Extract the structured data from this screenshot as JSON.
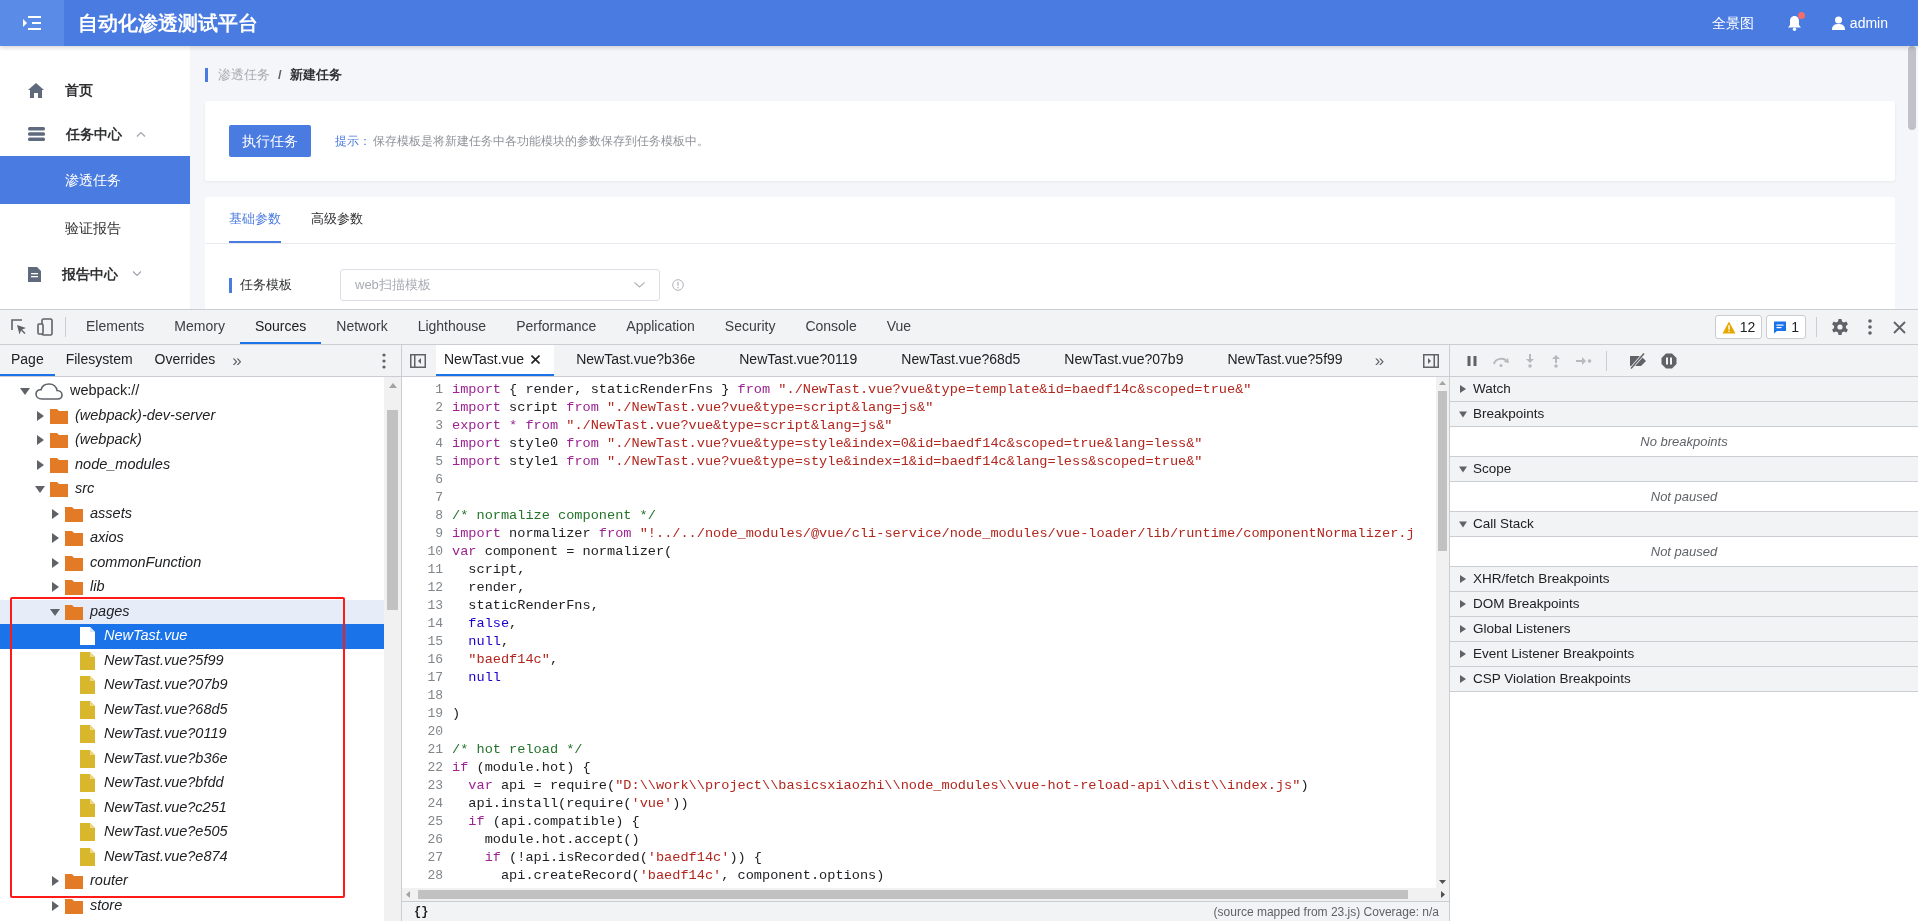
{
  "header": {
    "title": "自动化渗透测试平台",
    "overview_link": "全景图",
    "bell": {
      "unread": true
    },
    "user": "admin"
  },
  "sidebar": {
    "items": [
      {
        "label": "首页",
        "kind": "home",
        "selected": false
      },
      {
        "label": "任务中心",
        "kind": "stack",
        "expanded": true,
        "selected": false,
        "children": [
          {
            "label": "渗透任务",
            "selected": true
          },
          {
            "label": "验证报告",
            "selected": false
          }
        ]
      },
      {
        "label": "报告中心",
        "kind": "document",
        "expanded": false,
        "selected": false
      }
    ]
  },
  "breadcrumb": [
    "渗透任务",
    "新建任务"
  ],
  "breadcrumb_separator": "/",
  "action_card": {
    "button": "执行任务",
    "tip_label": "提示：",
    "tip_text": "保存模板是将新建任务中各功能模块的参数保存到任务模板中。"
  },
  "form_tabs": [
    {
      "label": "基础参数",
      "selected": true
    },
    {
      "label": "高级参数",
      "selected": false
    }
  ],
  "form": {
    "label": "任务模板",
    "select_value": "web扫描模板"
  },
  "devtools": {
    "tabs": [
      {
        "label": "Elements",
        "selected": false
      },
      {
        "label": "Memory",
        "selected": false
      },
      {
        "label": "Sources",
        "selected": true
      },
      {
        "label": "Network",
        "selected": false
      },
      {
        "label": "Lighthouse",
        "selected": false
      },
      {
        "label": "Performance",
        "selected": false
      },
      {
        "label": "Application",
        "selected": false
      },
      {
        "label": "Security",
        "selected": false
      },
      {
        "label": "Console",
        "selected": false
      },
      {
        "label": "Vue",
        "selected": false
      }
    ],
    "warnings": "12",
    "messages": "1",
    "navigator_tabs": [
      {
        "label": "Page",
        "selected": true
      },
      {
        "label": "Filesystem",
        "selected": false
      },
      {
        "label": "Overrides",
        "selected": false
      }
    ],
    "navigator_more": "»",
    "tree": [
      {
        "label": "webpack://",
        "kind": "cloud",
        "expanded": true,
        "selected": false,
        "hovered": false,
        "children": [
          {
            "label": "(webpack)-dev-server",
            "kind": "folder",
            "expanded": false,
            "selected": false,
            "hovered": false
          },
          {
            "label": "(webpack)",
            "kind": "folder",
            "expanded": false,
            "selected": false,
            "hovered": false
          },
          {
            "label": "node_modules",
            "kind": "folder",
            "expanded": false,
            "selected": false,
            "hovered": false
          },
          {
            "label": "src",
            "kind": "folder",
            "expanded": true,
            "selected": false,
            "hovered": false,
            "children": [
              {
                "label": "assets",
                "kind": "folder",
                "expanded": false,
                "selected": false,
                "hovered": false
              },
              {
                "label": "axios",
                "kind": "folder",
                "expanded": false,
                "selected": false,
                "hovered": false
              },
              {
                "label": "commonFunction",
                "kind": "folder",
                "expanded": false,
                "selected": false,
                "hovered": false
              },
              {
                "label": "lib",
                "kind": "folder",
                "expanded": false,
                "selected": false,
                "hovered": false
              },
              {
                "label": "pages",
                "kind": "folder",
                "expanded": true,
                "selected": false,
                "hovered": true,
                "children": [
                  {
                    "label": "NewTast.vue",
                    "kind": "file",
                    "selected": true,
                    "hovered": false
                  },
                  {
                    "label": "NewTast.vue?5f99",
                    "kind": "file",
                    "selected": false,
                    "hovered": false
                  },
                  {
                    "label": "NewTast.vue?07b9",
                    "kind": "file",
                    "selected": false,
                    "hovered": false
                  },
                  {
                    "label": "NewTast.vue?68d5",
                    "kind": "file",
                    "selected": false,
                    "hovered": false
                  },
                  {
                    "label": "NewTast.vue?0119",
                    "kind": "file",
                    "selected": false,
                    "hovered": false
                  },
                  {
                    "label": "NewTast.vue?b36e",
                    "kind": "file",
                    "selected": false,
                    "hovered": false
                  },
                  {
                    "label": "NewTast.vue?bfdd",
                    "kind": "file",
                    "selected": false,
                    "hovered": false
                  },
                  {
                    "label": "NewTast.vue?c251",
                    "kind": "file",
                    "selected": false,
                    "hovered": false
                  },
                  {
                    "label": "NewTast.vue?e505",
                    "kind": "file",
                    "selected": false,
                    "hovered": false
                  },
                  {
                    "label": "NewTast.vue?e874",
                    "kind": "file",
                    "selected": false,
                    "hovered": false
                  }
                ]
              },
              {
                "label": "router",
                "kind": "folder",
                "expanded": false,
                "selected": false,
                "hovered": false
              },
              {
                "label": "store",
                "kind": "folder",
                "expanded": false,
                "selected": false,
                "hovered": false
              }
            ]
          }
        ]
      }
    ],
    "editor_tabs": [
      {
        "label": "NewTast.vue",
        "selected": true
      },
      {
        "label": "NewTast.vue?b36e",
        "selected": false
      },
      {
        "label": "NewTast.vue?0119",
        "selected": false
      },
      {
        "label": "NewTast.vue?68d5",
        "selected": false
      },
      {
        "label": "NewTast.vue?07b9",
        "selected": false
      },
      {
        "label": "NewTast.vue?5f99",
        "selected": false
      }
    ],
    "editor_more": "»",
    "code": [
      {
        "number": "1",
        "tokens": [
          {
            "kind": "kw",
            "text": "import"
          },
          {
            "kind": "plain",
            "text": " { render, staticRenderFns } "
          },
          {
            "kind": "kw",
            "text": "from "
          },
          {
            "kind": "str",
            "text": "\"./NewTast.vue?vue&type=template&id=baedf14c&scoped=true&\""
          }
        ]
      },
      {
        "number": "2",
        "tokens": [
          {
            "kind": "kw",
            "text": "import"
          },
          {
            "kind": "plain",
            "text": " script "
          },
          {
            "kind": "kw",
            "text": "from "
          },
          {
            "kind": "str",
            "text": "\"./NewTast.vue?vue&type=script&lang=js&\""
          }
        ]
      },
      {
        "number": "3",
        "tokens": [
          {
            "kind": "kw",
            "text": "export * from "
          },
          {
            "kind": "str",
            "text": "\"./NewTast.vue?vue&type=script&lang=js&\""
          }
        ]
      },
      {
        "number": "4",
        "tokens": [
          {
            "kind": "kw",
            "text": "import"
          },
          {
            "kind": "plain",
            "text": " style0 "
          },
          {
            "kind": "kw",
            "text": "from "
          },
          {
            "kind": "str",
            "text": "\"./NewTast.vue?vue&type=style&index=0&id=baedf14c&scoped=true&lang=less&\""
          }
        ]
      },
      {
        "number": "5",
        "tokens": [
          {
            "kind": "kw",
            "text": "import"
          },
          {
            "kind": "plain",
            "text": " style1 "
          },
          {
            "kind": "kw",
            "text": "from "
          },
          {
            "kind": "str",
            "text": "\"./NewTast.vue?vue&type=style&index=1&id=baedf14c&lang=less&scoped=true&\""
          }
        ]
      },
      {
        "number": "6"
      },
      {
        "number": "7"
      },
      {
        "number": "8",
        "tokens": [
          {
            "kind": "com",
            "text": "/* normalize component */"
          }
        ]
      },
      {
        "number": "9",
        "tokens": [
          {
            "kind": "kw",
            "text": "import"
          },
          {
            "kind": "plain",
            "text": " normalizer "
          },
          {
            "kind": "kw",
            "text": "from "
          },
          {
            "kind": "str",
            "text": "\"!../../node_modules/@vue/cli-service/node_modules/vue-loader/lib/runtime/componentNormalizer.j"
          }
        ]
      },
      {
        "number": "10",
        "tokens": [
          {
            "kind": "kw",
            "text": "var"
          },
          {
            "kind": "plain",
            "text": " component = normalizer("
          }
        ]
      },
      {
        "number": "11",
        "tokens": [
          {
            "kind": "plain",
            "text": "  script,"
          }
        ]
      },
      {
        "number": "12",
        "tokens": [
          {
            "kind": "plain",
            "text": "  render,"
          }
        ]
      },
      {
        "number": "13",
        "tokens": [
          {
            "kind": "plain",
            "text": "  staticRenderFns,"
          }
        ]
      },
      {
        "number": "14",
        "tokens": [
          {
            "kind": "lit",
            "text": "  false"
          },
          {
            "kind": "plain",
            "text": ","
          }
        ]
      },
      {
        "number": "15",
        "tokens": [
          {
            "kind": "lit",
            "text": "  null"
          },
          {
            "kind": "plain",
            "text": ","
          }
        ]
      },
      {
        "number": "16",
        "tokens": [
          {
            "kind": "str",
            "text": "  \"baedf14c\""
          },
          {
            "kind": "plain",
            "text": ","
          }
        ]
      },
      {
        "number": "17",
        "tokens": [
          {
            "kind": "lit",
            "text": "  null"
          }
        ]
      },
      {
        "number": "18"
      },
      {
        "number": "19",
        "tokens": [
          {
            "kind": "plain",
            "text": ")"
          }
        ]
      },
      {
        "number": "20"
      },
      {
        "number": "21",
        "tokens": [
          {
            "kind": "com",
            "text": "/* hot reload */"
          }
        ]
      },
      {
        "number": "22",
        "tokens": [
          {
            "kind": "kw",
            "text": "if"
          },
          {
            "kind": "plain",
            "text": " (module.hot) {"
          }
        ]
      },
      {
        "number": "23",
        "tokens": [
          {
            "kind": "kw",
            "text": "  var"
          },
          {
            "kind": "plain",
            "text": " api = require("
          },
          {
            "kind": "str",
            "text": "\"D:\\\\work\\\\project\\\\basicsxiaozhi\\\\node_modules\\\\vue-hot-reload-api\\\\dist\\\\index.js\""
          },
          {
            "kind": "plain",
            "text": ")"
          }
        ]
      },
      {
        "number": "24",
        "tokens": [
          {
            "kind": "plain",
            "text": "  api.install(require("
          },
          {
            "kind": "str",
            "text": "'vue'"
          },
          {
            "kind": "plain",
            "text": "))"
          }
        ]
      },
      {
        "number": "25",
        "tokens": [
          {
            "kind": "kw",
            "text": "  if"
          },
          {
            "kind": "plain",
            "text": " (api.compatible) {"
          }
        ]
      },
      {
        "number": "26",
        "tokens": [
          {
            "kind": "plain",
            "text": "    module.hot.accept()"
          }
        ]
      },
      {
        "number": "27",
        "tokens": [
          {
            "kind": "kw",
            "text": "    if"
          },
          {
            "kind": "plain",
            "text": " (!api.isRecorded("
          },
          {
            "kind": "str",
            "text": "'baedf14c'"
          },
          {
            "kind": "plain",
            "text": ")) {"
          }
        ]
      },
      {
        "number": "28",
        "tokens": [
          {
            "kind": "plain",
            "text": "      api.createRecord("
          },
          {
            "kind": "str",
            "text": "'baedf14c'"
          },
          {
            "kind": "plain",
            "text": ", component.options)"
          }
        ]
      }
    ],
    "status": {
      "format_button": "{}",
      "text": "(source mapped from 23.js) Coverage: n/a"
    },
    "debugger_toolbar": [
      {
        "kind": "pause",
        "disabled": false
      },
      {
        "kind": "step_over",
        "disabled": true
      },
      {
        "kind": "step_into",
        "disabled": true
      },
      {
        "kind": "step_out",
        "disabled": true
      },
      {
        "kind": "step",
        "disabled": true
      },
      {
        "kind": "deactivate",
        "disabled": false
      },
      {
        "kind": "pause_exceptions",
        "disabled": false
      }
    ],
    "sections": [
      {
        "title": "Watch",
        "expanded": false
      },
      {
        "title": "Breakpoints",
        "expanded": true,
        "message": "No breakpoints"
      },
      {
        "title": "Scope",
        "expanded": true,
        "message": "Not paused"
      },
      {
        "title": "Call Stack",
        "expanded": true,
        "message": "Not paused"
      },
      {
        "title": "XHR/fetch Breakpoints",
        "expanded": false
      },
      {
        "title": "DOM Breakpoints",
        "expanded": false
      },
      {
        "title": "Global Listeners",
        "expanded": false
      },
      {
        "title": "Event Listener Breakpoints",
        "expanded": false
      },
      {
        "title": "CSP Violation Breakpoints",
        "expanded": false
      }
    ]
  }
}
